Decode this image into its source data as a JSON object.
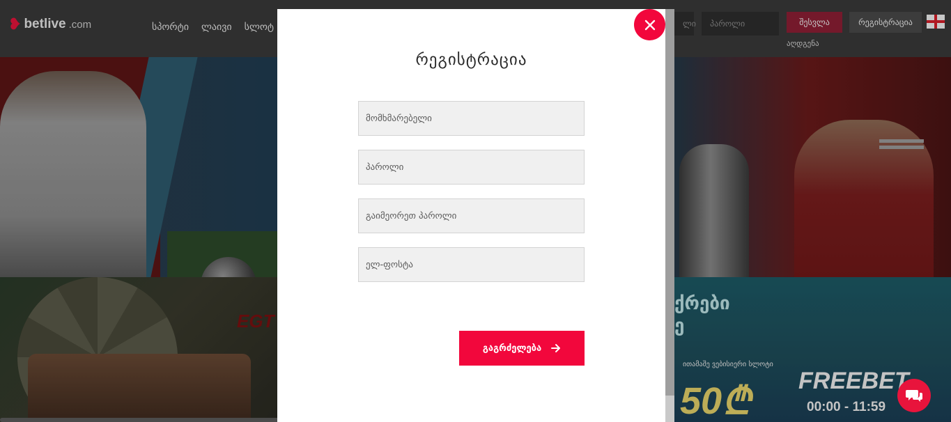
{
  "header": {
    "logo_text": "betlive",
    "logo_suffix": ".com",
    "nav": [
      "სპორტი",
      "ლაივი",
      "სლოტ"
    ],
    "username_placeholder": "ლი",
    "password_placeholder": "პაროლი",
    "login_label": "შესვლა",
    "register_label": "რეგისტრაცია",
    "forgot_label": "აღდგენა",
    "language_flag": "georgia-flag-icon",
    "login_button_color": "#8e1f35"
  },
  "banners": {
    "egt_label": "EGT",
    "promo_title_line1": "ქრები",
    "promo_title_line2": "ე",
    "promo_subtitle": "ითამაშე ვებისიერი სლოტი",
    "promo_amount": "50₾",
    "promo_freebet": "FREEBET",
    "promo_time": "00:00 - 11:59"
  },
  "modal": {
    "title": "რეგისტრაცია",
    "fields": {
      "username": "მომხმარებელი",
      "password": "პაროლი",
      "repeat_password": "გაიმეორეთ პაროლი",
      "email": "ელ-ფოსტა"
    },
    "continue_label": "გაგრძელება",
    "continue_icon": "arrow-right-icon",
    "close_icon": "close-icon",
    "accent_color": "#f2073c"
  },
  "chat": {
    "icon": "chat-bubble-icon"
  }
}
